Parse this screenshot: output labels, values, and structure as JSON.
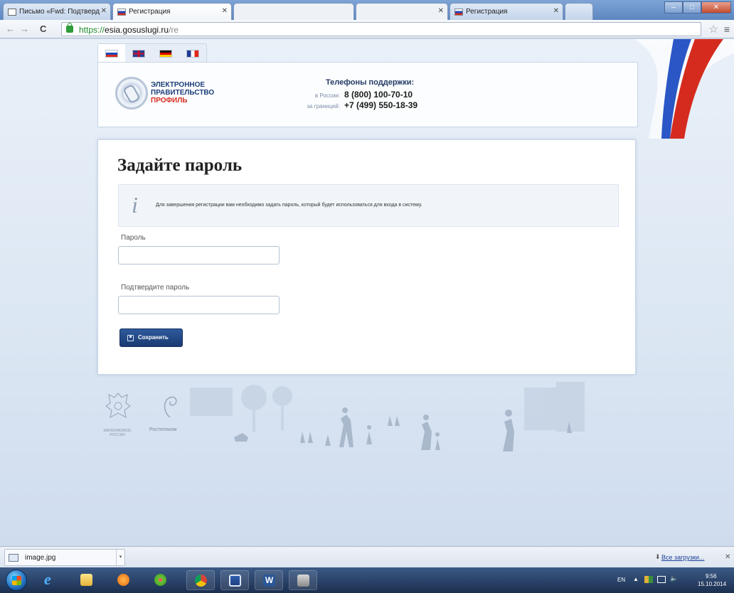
{
  "browser": {
    "tabs": [
      {
        "label": "Письмо «Fwd: Подтверд",
        "favicon": "document-icon"
      },
      {
        "label": "Регистрация",
        "favicon": "russian-flag-icon"
      },
      {
        "label": "",
        "favicon": ""
      },
      {
        "label": "",
        "favicon": ""
      },
      {
        "label": "Регистрация",
        "favicon": "russian-flag-icon"
      }
    ],
    "active_tab_index": 1,
    "address": {
      "scheme": "https://",
      "host": "esia.gosuslugi.ru",
      "path": "/re"
    }
  },
  "header": {
    "languages": [
      "ru",
      "en",
      "de",
      "fr"
    ],
    "active_language": "ru",
    "logo": {
      "line1": "ЭЛЕКТРОННОЕ",
      "line2": "ПРАВИТЕЛЬСТВО",
      "line3": "ПРОФИЛЬ"
    },
    "support": {
      "title": "Телефоны поддержки:",
      "rows": [
        {
          "label": "в России:",
          "number": "8 (800) 100-70-10"
        },
        {
          "label": "за границей:",
          "number": "+7 (499) 550-18-39"
        }
      ]
    }
  },
  "form": {
    "title": "Задайте пароль",
    "info": "Для завершения регистрации вам необходимо задать пароль, который будет использоваться для входа в систему.",
    "password_label": "Пароль",
    "password_value": "",
    "confirm_label": "Подтвердите пароль",
    "confirm_value": "",
    "save_label": "Сохранить"
  },
  "footer": {
    "coat_label": "МИНКОМСВЯЗЬ РОССИИ",
    "rostelecom_label": "Ростелеком"
  },
  "downloads": {
    "file_name": "image.jpg",
    "all_label": "Все загрузки..."
  },
  "taskbar": {
    "language": "EN",
    "time": "9:56",
    "date": "15.10.2014"
  },
  "colors": {
    "brand_blue": "#1c3f7a",
    "brand_red": "#d52b1e",
    "button_blue": "#1a3a72"
  }
}
